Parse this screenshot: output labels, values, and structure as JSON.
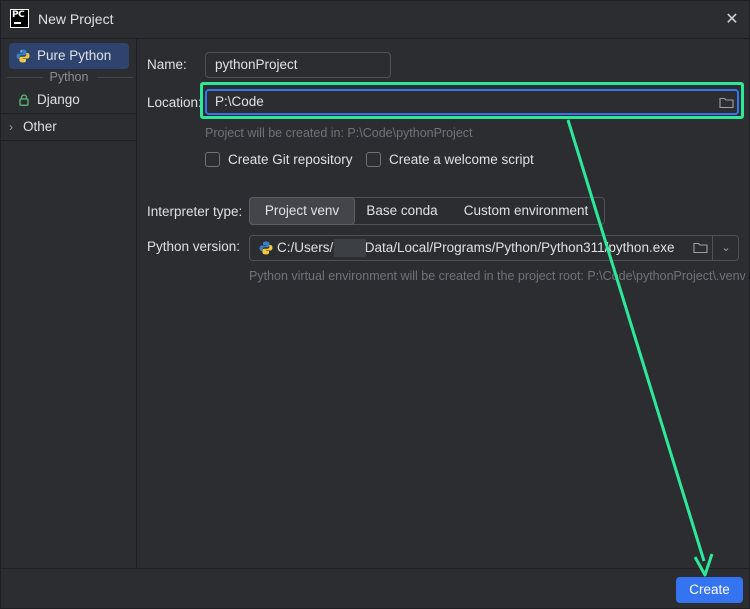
{
  "window": {
    "title": "New Project",
    "app_icon_text": "PC"
  },
  "sidebar": {
    "items": [
      {
        "label": "Pure Python",
        "selected": true,
        "icon": "python-icon"
      },
      {
        "label": "Django",
        "selected": false,
        "icon": "lock-icon"
      },
      {
        "label": "Other",
        "selected": false,
        "icon": "chevron-right-icon"
      }
    ],
    "group_label": "Python"
  },
  "form": {
    "name_label": "Name:",
    "name_value": "pythonProject",
    "location_label": "Location:",
    "location_value": "P:\\Code",
    "location_hint": "Project will be created in: P:\\Code\\pythonProject",
    "create_git_label": "Create Git repository",
    "create_git_checked": false,
    "welcome_script_label": "Create a welcome script",
    "welcome_script_checked": false,
    "interpreter_type_label": "Interpreter type:",
    "interpreter_types": [
      "Project venv",
      "Base conda",
      "Custom environment"
    ],
    "interpreter_selected": "Project venv",
    "python_version_label": "Python version:",
    "python_version_value": "C:/Users/       /AppData/Local/Programs/Python/Python311/python.exe",
    "venv_hint": "Python virtual environment will be created in the project root: P:\\Code\\pythonProject\\.venv"
  },
  "footer": {
    "create_label": "Create"
  },
  "colors": {
    "accent": "#3574f0",
    "annotation": "#2ee89a",
    "background": "#2b2d30",
    "selected": "#2e436e"
  }
}
